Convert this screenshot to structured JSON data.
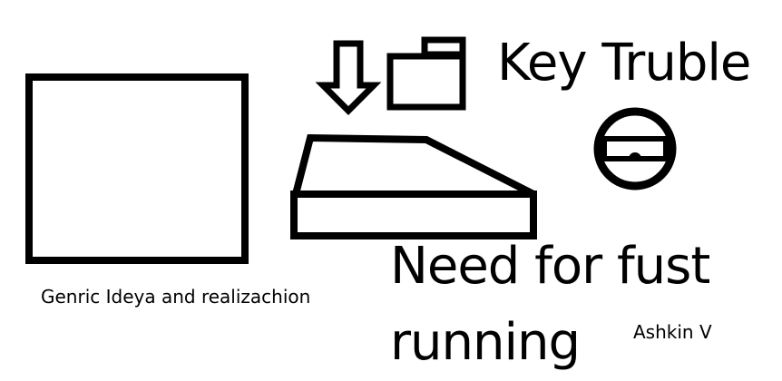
{
  "title": "Key Truble",
  "caption": "Genric Ideya and realizachion",
  "subtitle": "Need for fust running",
  "author": "Ashkin V",
  "icons": {
    "arrow": "download-arrow-icon",
    "folder": "folder-icon",
    "keyboard": "keyboard-icon",
    "lock": "lock-icon"
  },
  "colors": {
    "ink": "#000000",
    "background": "#ffffff"
  }
}
